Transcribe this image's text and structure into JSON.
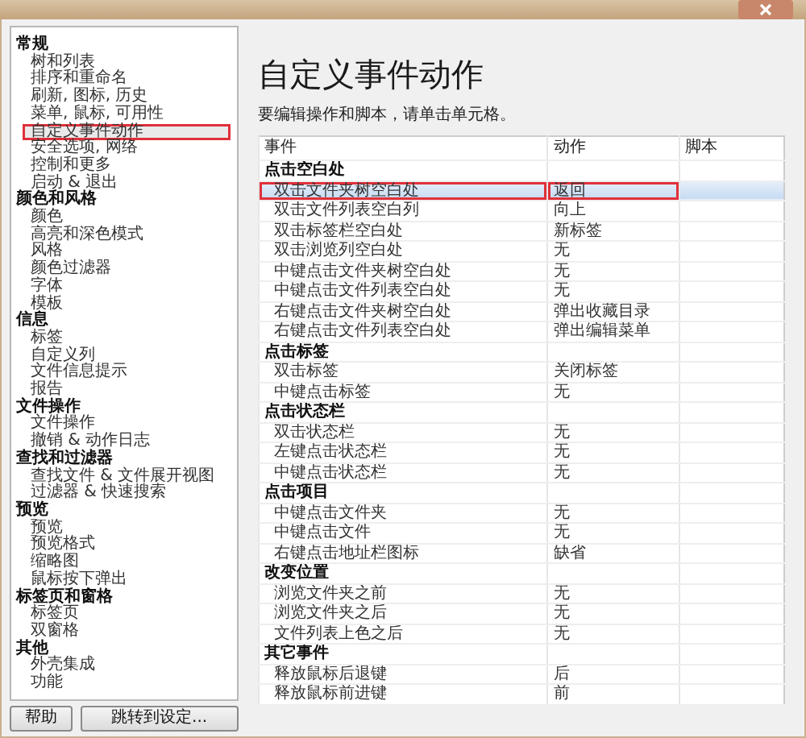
{
  "sidebar": {
    "groups": [
      {
        "label": "常规",
        "items": [
          {
            "label": "树和列表",
            "selected": false
          },
          {
            "label": "排序和重命名",
            "selected": false
          },
          {
            "label": "刷新, 图标, 历史",
            "selected": false
          },
          {
            "label": "菜单, 鼠标, 可用性",
            "selected": false
          },
          {
            "label": "自定义事件动作",
            "selected": true
          },
          {
            "label": "安全选项, 网络",
            "selected": false
          },
          {
            "label": "控制和更多",
            "selected": false
          },
          {
            "label": "启动 & 退出",
            "selected": false
          }
        ]
      },
      {
        "label": "颜色和风格",
        "items": [
          {
            "label": "颜色",
            "selected": false
          },
          {
            "label": "高亮和深色模式",
            "selected": false
          },
          {
            "label": "风格",
            "selected": false
          },
          {
            "label": "颜色过滤器",
            "selected": false
          },
          {
            "label": "字体",
            "selected": false
          },
          {
            "label": "模板",
            "selected": false
          }
        ]
      },
      {
        "label": "信息",
        "items": [
          {
            "label": "标签",
            "selected": false
          },
          {
            "label": "自定义列",
            "selected": false
          },
          {
            "label": "文件信息提示",
            "selected": false
          },
          {
            "label": "报告",
            "selected": false
          }
        ]
      },
      {
        "label": "文件操作",
        "items": [
          {
            "label": "文件操作",
            "selected": false
          },
          {
            "label": "撤销 & 动作日志",
            "selected": false
          }
        ]
      },
      {
        "label": "查找和过滤器",
        "items": [
          {
            "label": "查找文件 & 文件展开视图",
            "selected": false
          },
          {
            "label": "过滤器 & 快速搜索",
            "selected": false
          }
        ]
      },
      {
        "label": "预览",
        "items": [
          {
            "label": "预览",
            "selected": false
          },
          {
            "label": "预览格式",
            "selected": false
          },
          {
            "label": "缩略图",
            "selected": false
          },
          {
            "label": "鼠标按下弹出",
            "selected": false
          }
        ]
      },
      {
        "label": "标签页和窗格",
        "items": [
          {
            "label": "标签页",
            "selected": false
          },
          {
            "label": "双窗格",
            "selected": false
          }
        ]
      },
      {
        "label": "其他",
        "items": [
          {
            "label": "外壳集成",
            "selected": false
          },
          {
            "label": "功能",
            "selected": false
          }
        ]
      }
    ]
  },
  "buttons": [
    "帮助",
    "跳转到设定..."
  ],
  "heading": "自定义事件动作",
  "description": "要编辑操作和脚本，请单击单元格。",
  "table": {
    "columns": [
      "事件",
      "动作",
      "脚本"
    ],
    "groups": [
      {
        "label": "点击空白处",
        "rows": [
          {
            "event": "双击文件夹树空白处",
            "action": "返回",
            "selected": true
          },
          {
            "event": "双击文件列表空白列",
            "action": "向上",
            "selected": false
          },
          {
            "event": "双击标签栏空白处",
            "action": "新标签",
            "selected": false
          },
          {
            "event": "双击浏览列空白处",
            "action": "无",
            "selected": false
          },
          {
            "event": "中键点击文件夹树空白处",
            "action": "无",
            "selected": false
          },
          {
            "event": "中键点击文件列表空白处",
            "action": "无",
            "selected": false
          },
          {
            "event": "右键点击文件夹树空白处",
            "action": "弹出收藏目录",
            "selected": false
          },
          {
            "event": "右键点击文件列表空白处",
            "action": "弹出编辑菜单",
            "selected": false
          }
        ]
      },
      {
        "label": "点击标签",
        "rows": [
          {
            "event": "双击标签",
            "action": "关闭标签",
            "selected": false
          },
          {
            "event": "中键点击标签",
            "action": "无",
            "selected": false
          }
        ]
      },
      {
        "label": "点击状态栏",
        "rows": [
          {
            "event": "双击状态栏",
            "action": "无",
            "selected": false
          },
          {
            "event": "左键点击状态栏",
            "action": "无",
            "selected": false
          },
          {
            "event": "中键点击状态栏",
            "action": "无",
            "selected": false
          }
        ]
      },
      {
        "label": "点击项目",
        "rows": [
          {
            "event": "中键点击文件夹",
            "action": "无",
            "selected": false
          },
          {
            "event": "中键点击文件",
            "action": "无",
            "selected": false
          },
          {
            "event": "右键点击地址栏图标",
            "action": "缺省",
            "selected": false
          }
        ]
      },
      {
        "label": "改变位置",
        "rows": [
          {
            "event": "浏览文件夹之前",
            "action": "无",
            "selected": false
          },
          {
            "event": "浏览文件夹之后",
            "action": "无",
            "selected": false
          },
          {
            "event": "文件列表上色之后",
            "action": "无",
            "selected": false
          }
        ]
      },
      {
        "label": "其它事件",
        "rows": [
          {
            "event": "释放鼠标后退键",
            "action": "后",
            "selected": false
          },
          {
            "event": "释放鼠标前进键",
            "action": "前",
            "selected": false
          }
        ]
      }
    ]
  }
}
